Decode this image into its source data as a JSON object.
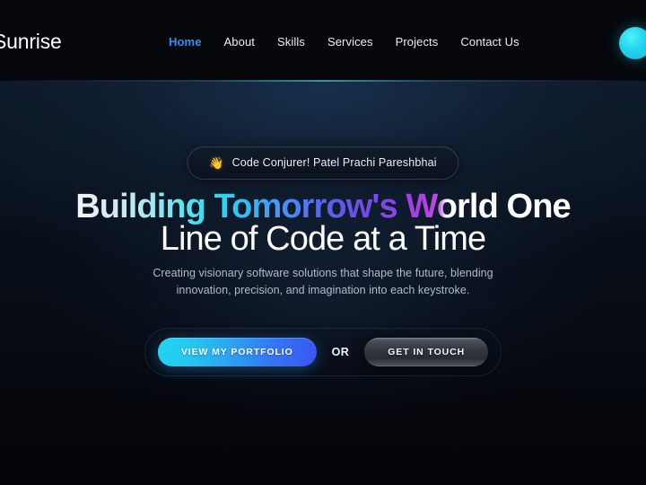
{
  "header": {
    "logo": "Sunrise",
    "nav": [
      {
        "label": "Home",
        "active": true
      },
      {
        "label": "About",
        "active": false
      },
      {
        "label": "Skills",
        "active": false
      },
      {
        "label": "Services",
        "active": false
      },
      {
        "label": "Projects",
        "active": false
      },
      {
        "label": "Contact Us",
        "active": false
      }
    ],
    "accent_color": "#2f8fef",
    "orb_color": "#22d3ee"
  },
  "hero": {
    "badge": {
      "emoji": "👋",
      "emoji_name": "waving-hand-icon",
      "text": "Code Conjurer! Patel Prachi Pareshbhai"
    },
    "headline": {
      "line1_gradient": "Building Tomorrow's World",
      "line1_plain": "One",
      "line2": "Line of Code at a Time"
    },
    "subtitle": {
      "line1": "Creating visionary software solutions that shape the future, blending",
      "line2": "innovation, precision, and imagination into each keystroke."
    },
    "cta": {
      "primary_label": "VIEW MY PORTFOLIO",
      "divider_label": "OR",
      "secondary_label": "GET IN TOUCH",
      "primary_gradient_from": "#22d3ee",
      "primary_gradient_to": "#3a55f2"
    }
  }
}
